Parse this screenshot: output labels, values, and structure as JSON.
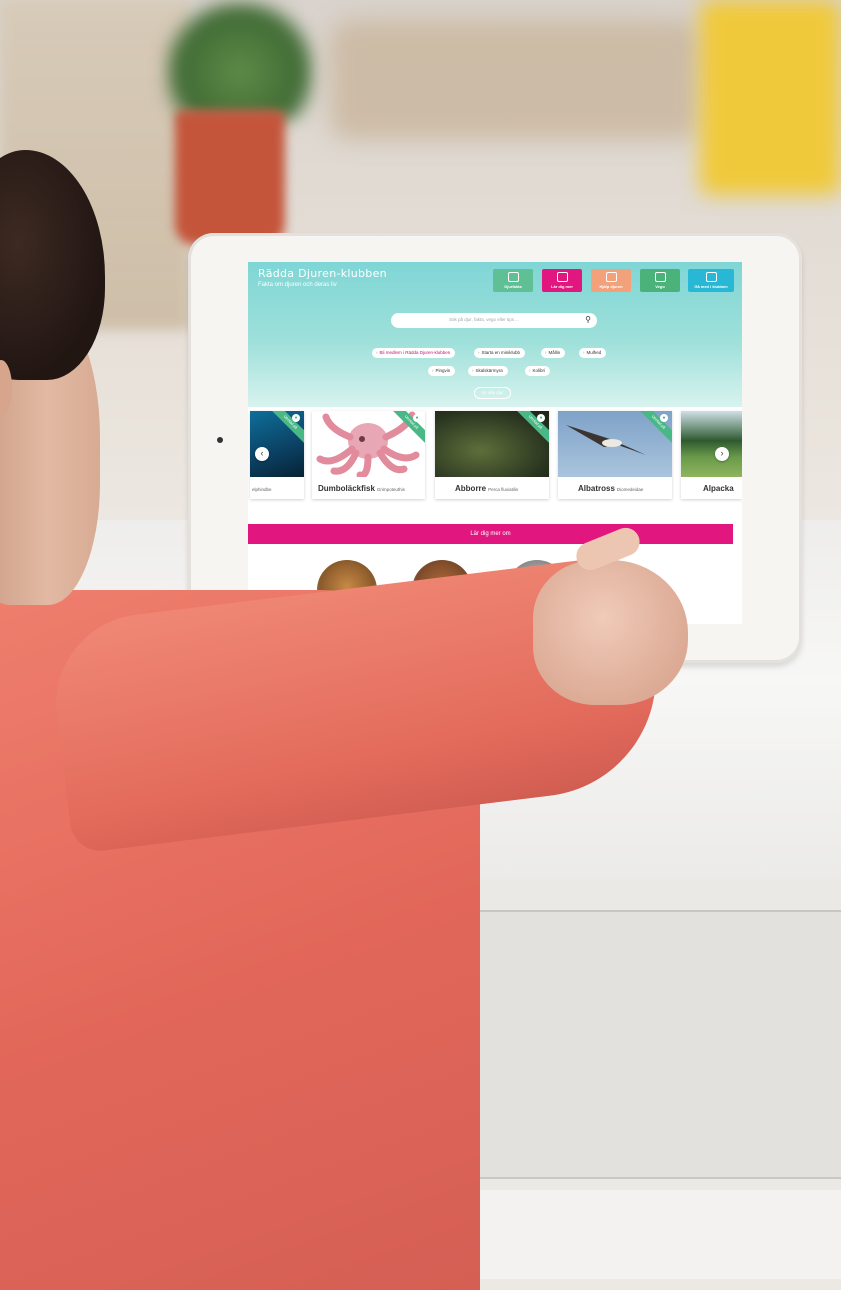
{
  "site": {
    "title": "Rädda Djuren-klubben",
    "subtitle": "Fakta om djuren och deras liv"
  },
  "nav": [
    {
      "label": "Djurfakta",
      "color": "#5fbf95"
    },
    {
      "label": "Lär dig mer",
      "color": "#e1177f"
    },
    {
      "label": "Hjälp djuren",
      "color": "#f2a17a"
    },
    {
      "label": "Vego",
      "color": "#4bb27a"
    },
    {
      "label": "Gå med i klubben",
      "color": "#28b8d5"
    }
  ],
  "search": {
    "placeholder": "Sök på djur, fakta, vego eller tips ..."
  },
  "chips": [
    "Bli medlem i Rädda Djuren-klubben",
    "Starta en miniklubb",
    "Mållin",
    "Mulhed",
    "Pingvin",
    "Skalskärmyra",
    "Kolibri"
  ],
  "more_label": "Se alla djur",
  "cards": [
    {
      "name": "",
      "sci": "elphindbe",
      "ribbon": "Utrotad på"
    },
    {
      "name": "Dumboläckfisk",
      "sci": "Grimpoteuthis",
      "ribbon": "Utrotad på"
    },
    {
      "name": "Abborre",
      "sci": "Perca fluviatilis",
      "ribbon": "Utrotad på"
    },
    {
      "name": "Albatross",
      "sci": "Diomedeidae",
      "ribbon": "Utrotad på"
    },
    {
      "name": "Alpacka",
      "sci": "",
      "ribbon": ""
    }
  ],
  "learn_more": "Lär dig mer om",
  "colors": {
    "brand_pink": "#e1177f",
    "hero_teal": "#7fd6d6",
    "ribbon_green": "#4ab886"
  }
}
